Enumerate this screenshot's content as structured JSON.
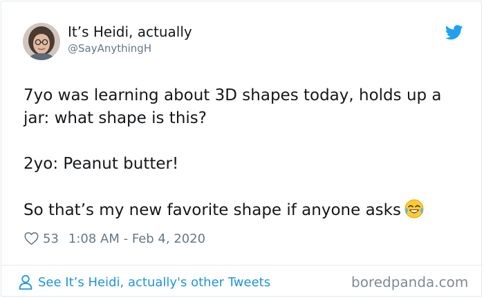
{
  "tweet": {
    "author_name": "It’s Heidi, actually",
    "author_handle": "@SayAnythingH",
    "lines": [
      "7yo was learning about 3D shapes today, holds up a",
      "jar: what shape is this?",
      "",
      "2yo: Peanut butter!",
      "",
      "So that’s my new favorite shape if anyone asks"
    ],
    "emoji": "face-with-tears-of-joy",
    "likes": "53",
    "timestamp": "1:08 AM - Feb 4, 2020"
  },
  "footer": {
    "other_tweets_label": "See It’s Heidi, actually's other Tweets",
    "watermark": "boredpanda.com"
  },
  "colors": {
    "twitter_blue": "#1da1f2",
    "link_blue": "#1b95e0",
    "text": "#14171a",
    "secondary": "#657786",
    "border": "#e1e8ed"
  },
  "icons": {
    "brand": "twitter-bird-icon",
    "like": "heart-icon",
    "profile": "person-icon"
  }
}
